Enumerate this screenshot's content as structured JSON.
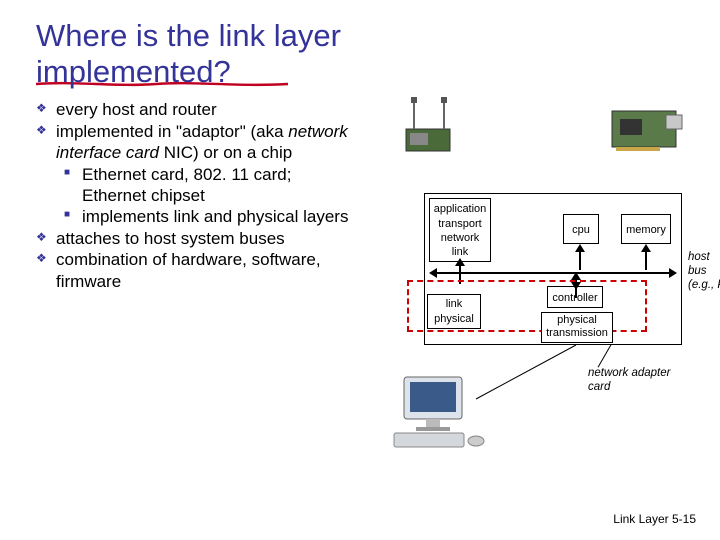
{
  "title_line1": "Where is the link layer",
  "title_line2": "implemented?",
  "bullets": {
    "b1": "every host and router",
    "b2a": "implemented in \"adaptor\" (aka ",
    "b2b": "network interface card",
    "b2c": " NIC) or on a chip",
    "b2s1": "Ethernet card, 802. 11 card; Ethernet chipset",
    "b2s2": "implements link and physical layers",
    "b3": "attaches to host system buses",
    "b4": "combination of hardware, software, firmware"
  },
  "diagram": {
    "stack": {
      "l1": "application",
      "l2": "transport",
      "l3": "network",
      "l4": "link"
    },
    "cpu": "cpu",
    "memory": "memory",
    "link": "link",
    "physical": "physical",
    "controller": "controller",
    "tx1": "physical",
    "tx2": "transmission",
    "host_bus1": "host",
    "host_bus2": "bus",
    "host_bus3": "(e.g., PCI)",
    "nic_label1": "network adapter",
    "nic_label2": "card"
  },
  "footer": "Link Layer  5-15"
}
